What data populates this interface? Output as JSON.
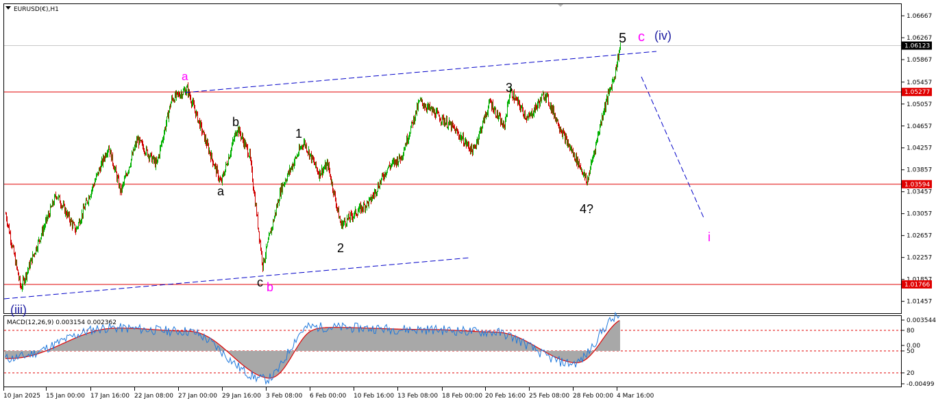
{
  "header": {
    "symbol_label": "EURUSD(€),H1",
    "macd_label": "MACD(12,26,9) 0.003154 0.002362"
  },
  "colors": {
    "background": "#ffffff",
    "bull_candle": "#00b000",
    "bear_candle": "#d00000",
    "level_line": "#e00000",
    "channel_line": "#0000c8",
    "macd_hist": "#a8a8a8",
    "macd_main": "#1e78dc",
    "macd_signal": "#e00000",
    "price_tag_bg": "#e00000",
    "current_price_tag_bg": "#000000",
    "wave_black": "#000000",
    "wave_magenta": "#ff00ff",
    "wave_blue": "#1a1aa0"
  },
  "chart_data": [
    {
      "type": "line",
      "name": "price",
      "x_labels": [
        "10 Jan 2025",
        "15 Jan 00:00",
        "17 Jan 16:00",
        "22 Jan 08:00",
        "27 Jan 00:00",
        "29 Jan 16:00",
        "3 Feb 08:00",
        "6 Feb 00:00",
        "10 Feb 16:00",
        "13 Feb 08:00",
        "18 Feb 00:00",
        "20 Feb 16:00",
        "25 Feb 08:00",
        "28 Feb 00:00",
        "4 Mar 16:00"
      ],
      "y_tick_labels": [
        "1.06667",
        "1.06267",
        "1.05867",
        "1.05457",
        "1.05057",
        "1.04657",
        "1.04257",
        "1.03857",
        "1.03457",
        "1.03057",
        "1.02657",
        "1.02257",
        "1.01857",
        "1.01457"
      ],
      "ylim": [
        1.0124,
        1.0688
      ],
      "current_price": "1.06123",
      "horizontal_levels": [
        "1.05277",
        "1.03594",
        "1.01766"
      ],
      "swing_points": [
        {
          "label": "(iii)",
          "price": 1.017
        },
        {
          "label": "a",
          "price": 1.0533
        },
        {
          "label": "b",
          "price": 1.0463
        },
        {
          "label": "a",
          "price": 1.0361
        },
        {
          "label": "c",
          "price": 1.0212
        },
        {
          "label": "1",
          "price": 1.0437
        },
        {
          "label": "2",
          "price": 1.0285
        },
        {
          "label": "3",
          "price": 1.053
        },
        {
          "label": "4?",
          "price": 1.0362
        },
        {
          "label": "5",
          "price": 1.0614
        }
      ],
      "wave_labels": [
        {
          "text": "5",
          "color": "black"
        },
        {
          "text": "c",
          "color": "magenta"
        },
        {
          "text": "(iv)",
          "color": "blue"
        },
        {
          "text": "a",
          "color": "magenta"
        },
        {
          "text": "3",
          "color": "black"
        },
        {
          "text": "b",
          "color": "black"
        },
        {
          "text": "1",
          "color": "black"
        },
        {
          "text": "a",
          "color": "black"
        },
        {
          "text": "4?",
          "color": "black"
        },
        {
          "text": "2",
          "color": "black"
        },
        {
          "text": "i",
          "color": "magenta"
        },
        {
          "text": "c",
          "color": "black"
        },
        {
          "text": "b",
          "color": "magenta"
        },
        {
          "text": "(iii)",
          "color": "blue"
        }
      ],
      "projection_target": {
        "label": "i",
        "price": 1.031
      }
    },
    {
      "type": "line",
      "name": "MACD(12,26,9)",
      "main_value": 0.003154,
      "signal_value": 0.002362,
      "y_tick_labels": [
        "0.003544",
        "80",
        "0.00",
        "50",
        "20",
        "-0.00499"
      ],
      "ylim": [
        -0.00499,
        0.003544
      ],
      "swing_values": [
        {
          "near": "10 Jan 2025",
          "value": -0.0016
        },
        {
          "near": "17 Jan 16:00",
          "value": 0.0021
        },
        {
          "near": "27 Jan 00:00",
          "value": 0.0017
        },
        {
          "near": "3 Feb 08:00",
          "value": -0.0041
        },
        {
          "near": "6 Feb 00:00",
          "value": 0.0022
        },
        {
          "near": "13 Feb 08:00",
          "value": 0.0019
        },
        {
          "near": "20 Feb 16:00",
          "value": 0.0016
        },
        {
          "near": "28 Feb 00:00",
          "value": -0.0022
        },
        {
          "near": "4 Mar 16:00",
          "value": 0.0035
        }
      ]
    }
  ]
}
